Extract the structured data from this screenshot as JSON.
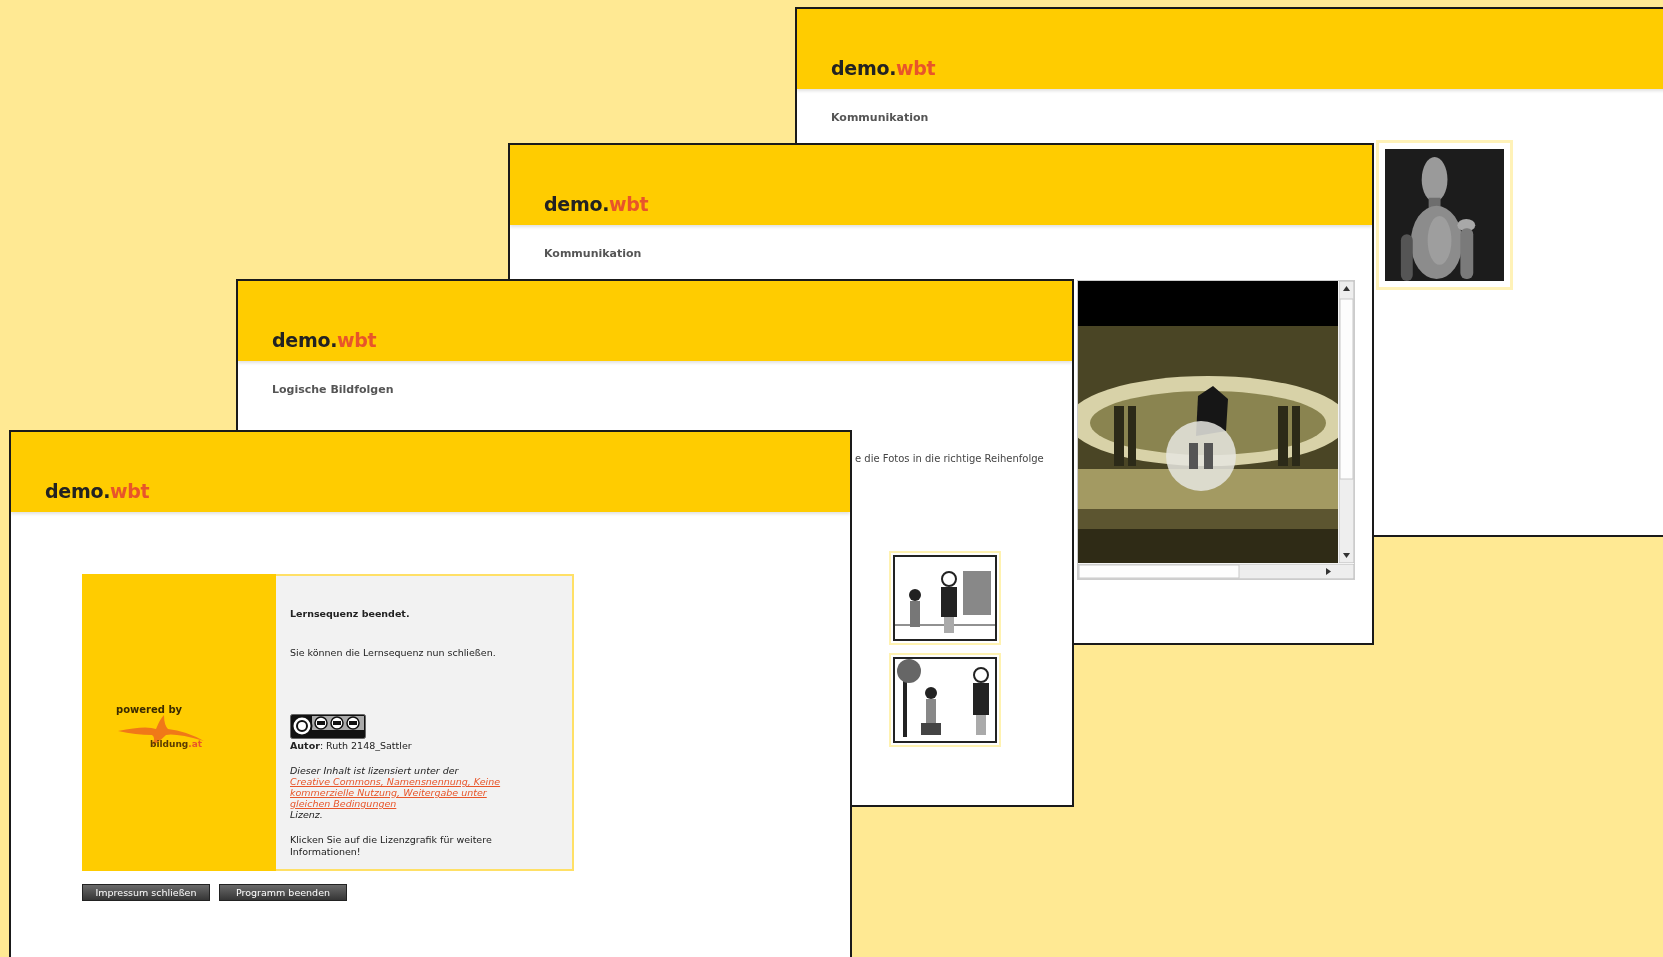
{
  "windows": [
    {
      "logo": {
        "text": "demo.",
        "accent": "wbt"
      },
      "heading": "Kommunikation"
    },
    {
      "kind": "video",
      "logo": {
        "text": "demo.",
        "accent": "wbt"
      },
      "heading": "Kommunikation"
    },
    {
      "kind": "sequence",
      "logo": {
        "text": "demo.",
        "accent": "wbt"
      },
      "heading": "Logische Bildfolgen",
      "instruction": "e die Fotos in die richtige Reihenfolge"
    },
    {
      "kind": "end",
      "logo": {
        "text": "demo.",
        "accent": "wbt"
      },
      "powered_by": "powered by",
      "partner": {
        "text": "bildung",
        "accent": ".at"
      },
      "title": "Lernsequenz beendet.",
      "message": "Sie können die Lernsequenz nun schließen.",
      "author": "**Autor**: Ruth 2148_Sattler",
      "license": {
        "before": "Dieser Inhalt ist lizensiert unter der",
        "link": "Creative Commons, Namensnennung, Keine kommerzielle Nutzung, Weitergabe unter gleichen Bedingungen",
        "after": "Lizenz."
      },
      "hint": "Klicken Sie auf die Lizenzgrafik für weitere Informationen!",
      "buttons": [
        "Impressum schließen",
        "Programm beenden"
      ]
    }
  ]
}
